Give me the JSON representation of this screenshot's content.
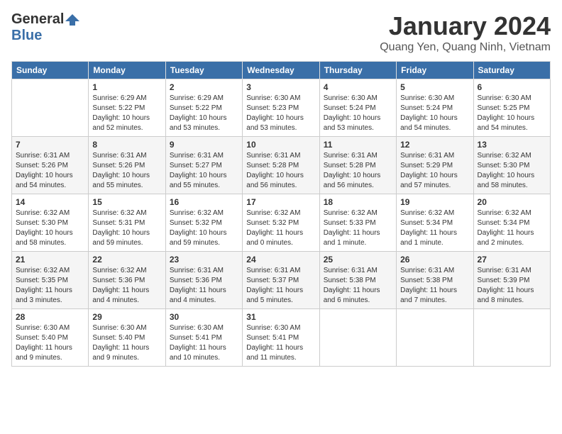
{
  "logo": {
    "general": "General",
    "blue": "Blue"
  },
  "title": {
    "month_year": "January 2024",
    "location": "Quang Yen, Quang Ninh, Vietnam"
  },
  "calendar": {
    "headers": [
      "Sunday",
      "Monday",
      "Tuesday",
      "Wednesday",
      "Thursday",
      "Friday",
      "Saturday"
    ],
    "weeks": [
      [
        {
          "day": "",
          "sunrise": "",
          "sunset": "",
          "daylight": ""
        },
        {
          "day": "1",
          "sunrise": "Sunrise: 6:29 AM",
          "sunset": "Sunset: 5:22 PM",
          "daylight": "Daylight: 10 hours and 52 minutes."
        },
        {
          "day": "2",
          "sunrise": "Sunrise: 6:29 AM",
          "sunset": "Sunset: 5:22 PM",
          "daylight": "Daylight: 10 hours and 53 minutes."
        },
        {
          "day": "3",
          "sunrise": "Sunrise: 6:30 AM",
          "sunset": "Sunset: 5:23 PM",
          "daylight": "Daylight: 10 hours and 53 minutes."
        },
        {
          "day": "4",
          "sunrise": "Sunrise: 6:30 AM",
          "sunset": "Sunset: 5:24 PM",
          "daylight": "Daylight: 10 hours and 53 minutes."
        },
        {
          "day": "5",
          "sunrise": "Sunrise: 6:30 AM",
          "sunset": "Sunset: 5:24 PM",
          "daylight": "Daylight: 10 hours and 54 minutes."
        },
        {
          "day": "6",
          "sunrise": "Sunrise: 6:30 AM",
          "sunset": "Sunset: 5:25 PM",
          "daylight": "Daylight: 10 hours and 54 minutes."
        }
      ],
      [
        {
          "day": "7",
          "sunrise": "Sunrise: 6:31 AM",
          "sunset": "Sunset: 5:26 PM",
          "daylight": "Daylight: 10 hours and 54 minutes."
        },
        {
          "day": "8",
          "sunrise": "Sunrise: 6:31 AM",
          "sunset": "Sunset: 5:26 PM",
          "daylight": "Daylight: 10 hours and 55 minutes."
        },
        {
          "day": "9",
          "sunrise": "Sunrise: 6:31 AM",
          "sunset": "Sunset: 5:27 PM",
          "daylight": "Daylight: 10 hours and 55 minutes."
        },
        {
          "day": "10",
          "sunrise": "Sunrise: 6:31 AM",
          "sunset": "Sunset: 5:28 PM",
          "daylight": "Daylight: 10 hours and 56 minutes."
        },
        {
          "day": "11",
          "sunrise": "Sunrise: 6:31 AM",
          "sunset": "Sunset: 5:28 PM",
          "daylight": "Daylight: 10 hours and 56 minutes."
        },
        {
          "day": "12",
          "sunrise": "Sunrise: 6:31 AM",
          "sunset": "Sunset: 5:29 PM",
          "daylight": "Daylight: 10 hours and 57 minutes."
        },
        {
          "day": "13",
          "sunrise": "Sunrise: 6:32 AM",
          "sunset": "Sunset: 5:30 PM",
          "daylight": "Daylight: 10 hours and 58 minutes."
        }
      ],
      [
        {
          "day": "14",
          "sunrise": "Sunrise: 6:32 AM",
          "sunset": "Sunset: 5:30 PM",
          "daylight": "Daylight: 10 hours and 58 minutes."
        },
        {
          "day": "15",
          "sunrise": "Sunrise: 6:32 AM",
          "sunset": "Sunset: 5:31 PM",
          "daylight": "Daylight: 10 hours and 59 minutes."
        },
        {
          "day": "16",
          "sunrise": "Sunrise: 6:32 AM",
          "sunset": "Sunset: 5:32 PM",
          "daylight": "Daylight: 10 hours and 59 minutes."
        },
        {
          "day": "17",
          "sunrise": "Sunrise: 6:32 AM",
          "sunset": "Sunset: 5:32 PM",
          "daylight": "Daylight: 11 hours and 0 minutes."
        },
        {
          "day": "18",
          "sunrise": "Sunrise: 6:32 AM",
          "sunset": "Sunset: 5:33 PM",
          "daylight": "Daylight: 11 hours and 1 minute."
        },
        {
          "day": "19",
          "sunrise": "Sunrise: 6:32 AM",
          "sunset": "Sunset: 5:34 PM",
          "daylight": "Daylight: 11 hours and 1 minute."
        },
        {
          "day": "20",
          "sunrise": "Sunrise: 6:32 AM",
          "sunset": "Sunset: 5:34 PM",
          "daylight": "Daylight: 11 hours and 2 minutes."
        }
      ],
      [
        {
          "day": "21",
          "sunrise": "Sunrise: 6:32 AM",
          "sunset": "Sunset: 5:35 PM",
          "daylight": "Daylight: 11 hours and 3 minutes."
        },
        {
          "day": "22",
          "sunrise": "Sunrise: 6:32 AM",
          "sunset": "Sunset: 5:36 PM",
          "daylight": "Daylight: 11 hours and 4 minutes."
        },
        {
          "day": "23",
          "sunrise": "Sunrise: 6:31 AM",
          "sunset": "Sunset: 5:36 PM",
          "daylight": "Daylight: 11 hours and 4 minutes."
        },
        {
          "day": "24",
          "sunrise": "Sunrise: 6:31 AM",
          "sunset": "Sunset: 5:37 PM",
          "daylight": "Daylight: 11 hours and 5 minutes."
        },
        {
          "day": "25",
          "sunrise": "Sunrise: 6:31 AM",
          "sunset": "Sunset: 5:38 PM",
          "daylight": "Daylight: 11 hours and 6 minutes."
        },
        {
          "day": "26",
          "sunrise": "Sunrise: 6:31 AM",
          "sunset": "Sunset: 5:38 PM",
          "daylight": "Daylight: 11 hours and 7 minutes."
        },
        {
          "day": "27",
          "sunrise": "Sunrise: 6:31 AM",
          "sunset": "Sunset: 5:39 PM",
          "daylight": "Daylight: 11 hours and 8 minutes."
        }
      ],
      [
        {
          "day": "28",
          "sunrise": "Sunrise: 6:30 AM",
          "sunset": "Sunset: 5:40 PM",
          "daylight": "Daylight: 11 hours and 9 minutes."
        },
        {
          "day": "29",
          "sunrise": "Sunrise: 6:30 AM",
          "sunset": "Sunset: 5:40 PM",
          "daylight": "Daylight: 11 hours and 9 minutes."
        },
        {
          "day": "30",
          "sunrise": "Sunrise: 6:30 AM",
          "sunset": "Sunset: 5:41 PM",
          "daylight": "Daylight: 11 hours and 10 minutes."
        },
        {
          "day": "31",
          "sunrise": "Sunrise: 6:30 AM",
          "sunset": "Sunset: 5:41 PM",
          "daylight": "Daylight: 11 hours and 11 minutes."
        },
        {
          "day": "",
          "sunrise": "",
          "sunset": "",
          "daylight": ""
        },
        {
          "day": "",
          "sunrise": "",
          "sunset": "",
          "daylight": ""
        },
        {
          "day": "",
          "sunrise": "",
          "sunset": "",
          "daylight": ""
        }
      ]
    ]
  }
}
